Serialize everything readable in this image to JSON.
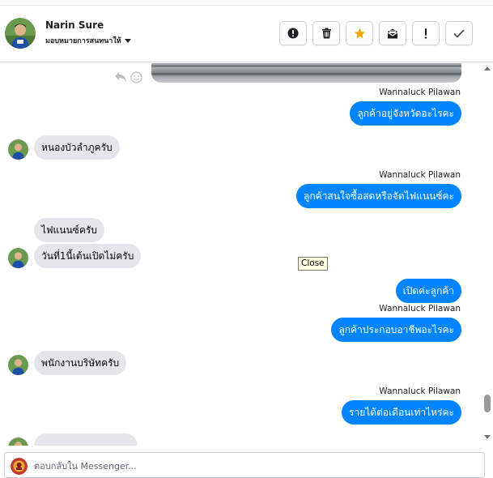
{
  "header": {
    "contact_name": "Narin Sure",
    "contact_status": "มอบหมายการสนทนาให้",
    "actions": [
      {
        "name": "spam",
        "icon": "alert-circle-icon"
      },
      {
        "name": "delete",
        "icon": "trash-icon"
      },
      {
        "name": "star",
        "icon": "star-icon",
        "color": "#f7a600"
      },
      {
        "name": "mark-unread",
        "icon": "envelope-icon"
      },
      {
        "name": "follow-up",
        "icon": "exclamation-icon"
      },
      {
        "name": "done",
        "icon": "checkmark-icon"
      }
    ]
  },
  "messages": [
    {
      "sender": "Wannaluck Pilawan",
      "text": "ลูกค้าอยู่จังหวัดอะไรคะ"
    },
    {
      "text": "หนองบัวลำภูครับ"
    },
    {
      "sender": "Wannaluck Pilawan",
      "text": "ลูกค้าสนใจซื้อสดหรือจัดไฟแนนซ์คะ"
    },
    {
      "text": "ไฟแนนซ์ครับ"
    },
    {
      "text": "วันที่1นี้เต้นเปิดไม่ครับ"
    },
    {
      "text": "เปิดค่ะลูกค้า"
    },
    {
      "sender": "Wannaluck Pilawan",
      "text": "ลูกค้าประกอบอาชีพอะไรคะ"
    },
    {
      "text": "พนักงานบริษัทครับ"
    },
    {
      "sender": "Wannaluck Pilawan",
      "text": "รายได้ต่อเดือนเท่าไหร่คะ"
    }
  ],
  "tooltip": "Close",
  "composer": {
    "placeholder": "ตอบกลับใน Messenger..."
  },
  "colors": {
    "outgoing": "#0084ff",
    "incoming": "#e4e6eb",
    "accent_star": "#f7a600"
  }
}
